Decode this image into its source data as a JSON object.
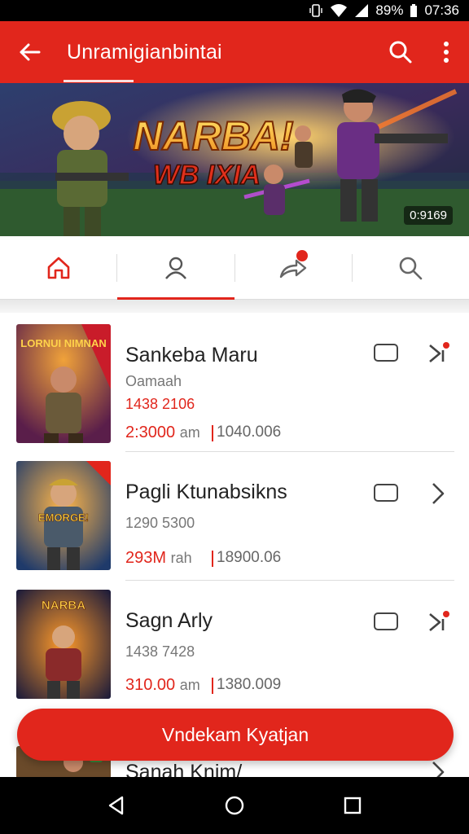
{
  "status_bar": {
    "battery": "89%",
    "time": "07:36"
  },
  "app_bar": {
    "title": "Unramigianbintai"
  },
  "banner": {
    "headline": "NARBA!",
    "subheadline": "WB IXIA",
    "duration": "0:9169"
  },
  "tabs": [
    {
      "icon": "home-icon",
      "active": false
    },
    {
      "icon": "profile-icon",
      "active": true
    },
    {
      "icon": "share-icon",
      "active": false,
      "badge": true
    },
    {
      "icon": "search-icon",
      "active": false
    }
  ],
  "items": [
    {
      "name": "Sankeba Maru",
      "sub1": "Oamaah",
      "sub2": "1438 2106",
      "price": "2:3000",
      "price_unit": "am",
      "price2": "1040.006",
      "thumb_label": "LORNUI NIMNAN",
      "trail_icon": "ai-action-icon"
    },
    {
      "name": "Pagli Ktunabsikns",
      "sub1": "",
      "sub2": "1290 5300",
      "price": "293M",
      "price_unit": "rah",
      "price2": "18900.06",
      "thumb_label": "EMORGE!",
      "trail_icon": "chevron-right-icon"
    },
    {
      "name": "Sagn Arly",
      "sub1": "",
      "sub2": "1438 7428",
      "price": "310.00",
      "price_unit": "am",
      "price2": "1380.009",
      "thumb_label": "NARBA",
      "trail_icon": "ai-action-icon"
    },
    {
      "name": "Sanah Knim/",
      "sub1": "",
      "sub2": "",
      "price": "",
      "price_unit": "",
      "price2": "",
      "thumb_label": "",
      "trail_icon": "chevron-right-icon"
    }
  ],
  "fab": {
    "label": "Vndekam Kyatjan"
  },
  "colors": {
    "accent": "#e1261c",
    "text": "#222222",
    "muted": "#777777"
  }
}
